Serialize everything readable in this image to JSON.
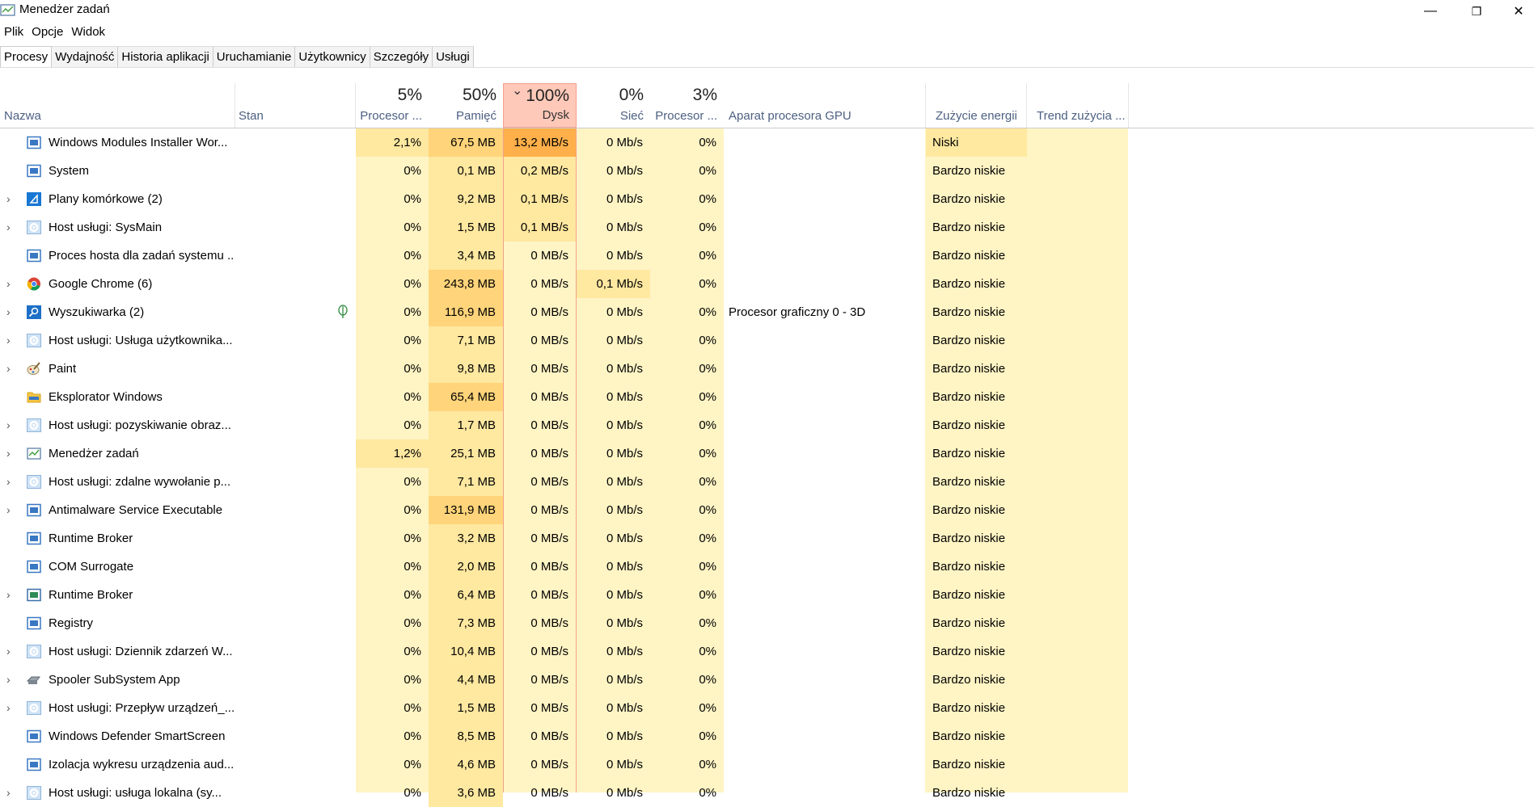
{
  "window": {
    "title": "Menedżer zadań",
    "minimize_glyph": "—",
    "restore_glyph": "❐",
    "close_glyph": "✕"
  },
  "menu": [
    "Plik",
    "Opcje",
    "Widok"
  ],
  "tabs": [
    "Procesy",
    "Wydajność",
    "Historia aplikacji",
    "Uruchamianie",
    "Użytkownicy",
    "Szczegóły",
    "Usługi"
  ],
  "active_tab": "Procesy",
  "columns": {
    "name": "Nazwa",
    "status": "Stan",
    "cpu": {
      "pct": "5%",
      "label": "Procesor ..."
    },
    "memory": {
      "pct": "50%",
      "label": "Pamięć"
    },
    "disk": {
      "pct": "100%",
      "label": "Dysk",
      "sort_arrow": "⌄"
    },
    "network": {
      "pct": "0%",
      "label": "Sieć"
    },
    "gpu": {
      "pct": "3%",
      "label": "Procesor ..."
    },
    "gpu_engine": "Aparat procesora GPU",
    "power": "Zużycie energii",
    "power_trend": "Trend zużycia ..."
  },
  "colors": {
    "heat_light": "#fff4c4",
    "heat_medium": "#ffe8a0",
    "heat_strong": "#ffd47a",
    "heat_hot": "#ffb04a",
    "disk_header_bg": "#ffc9b9",
    "disk_border": "#f4a08c",
    "header_label": "#4d6082"
  },
  "processes": [
    {
      "name": "Windows Modules Installer Wor...",
      "expand": "",
      "icon": "window-icon",
      "cpu": "2,1%",
      "mem": "67,5 MB",
      "disk": "13,2 MB/s",
      "net": "0 Mb/s",
      "gpu": "0%",
      "gpu_engine": "",
      "power": "Niski",
      "eco": false,
      "heat": {
        "cpu": "m",
        "mem": "s",
        "disk": "h",
        "net": "l",
        "power": "m"
      }
    },
    {
      "name": "System",
      "expand": "",
      "icon": "window-icon",
      "cpu": "0%",
      "mem": "0,1 MB",
      "disk": "0,2 MB/s",
      "net": "0 Mb/s",
      "gpu": "0%",
      "gpu_engine": "",
      "power": "Bardzo niskie",
      "eco": false,
      "heat": {
        "cpu": "l",
        "mem": "m",
        "disk": "m",
        "net": "l",
        "power": "l"
      }
    },
    {
      "name": "Plany komórkowe (2)",
      "expand": "›",
      "icon": "cellular-plans-icon",
      "cpu": "0%",
      "mem": "9,2 MB",
      "disk": "0,1 MB/s",
      "net": "0 Mb/s",
      "gpu": "0%",
      "gpu_engine": "",
      "power": "Bardzo niskie",
      "eco": false,
      "heat": {
        "cpu": "l",
        "mem": "m",
        "disk": "m",
        "net": "l",
        "power": "l"
      }
    },
    {
      "name": "Host usługi: SysMain",
      "expand": "›",
      "icon": "gear-icon",
      "cpu": "0%",
      "mem": "1,5 MB",
      "disk": "0,1 MB/s",
      "net": "0 Mb/s",
      "gpu": "0%",
      "gpu_engine": "",
      "power": "Bardzo niskie",
      "eco": false,
      "heat": {
        "cpu": "l",
        "mem": "m",
        "disk": "m",
        "net": "l",
        "power": "l"
      }
    },
    {
      "name": "Proces hosta dla zadań systemu ...",
      "expand": "",
      "icon": "window-icon",
      "cpu": "0%",
      "mem": "3,4 MB",
      "disk": "0 MB/s",
      "net": "0 Mb/s",
      "gpu": "0%",
      "gpu_engine": "",
      "power": "Bardzo niskie",
      "eco": false,
      "heat": {
        "cpu": "l",
        "mem": "m",
        "disk": "l",
        "net": "l",
        "power": "l"
      }
    },
    {
      "name": "Google Chrome (6)",
      "expand": "›",
      "icon": "chrome-icon",
      "cpu": "0%",
      "mem": "243,8 MB",
      "disk": "0 MB/s",
      "net": "0,1 Mb/s",
      "gpu": "0%",
      "gpu_engine": "",
      "power": "Bardzo niskie",
      "eco": false,
      "heat": {
        "cpu": "l",
        "mem": "s",
        "disk": "l",
        "net": "m",
        "power": "l"
      }
    },
    {
      "name": "Wyszukiwarka (2)",
      "expand": "›",
      "icon": "search-app-icon",
      "cpu": "0%",
      "mem": "116,9 MB",
      "disk": "0 MB/s",
      "net": "0 Mb/s",
      "gpu": "0%",
      "gpu_engine": "Procesor graficzny 0 - 3D",
      "power": "Bardzo niskie",
      "eco": true,
      "heat": {
        "cpu": "l",
        "mem": "s",
        "disk": "l",
        "net": "l",
        "power": "l"
      }
    },
    {
      "name": "Host usługi: Usługa użytkownika...",
      "expand": "›",
      "icon": "gear-icon",
      "cpu": "0%",
      "mem": "7,1 MB",
      "disk": "0 MB/s",
      "net": "0 Mb/s",
      "gpu": "0%",
      "gpu_engine": "",
      "power": "Bardzo niskie",
      "eco": false,
      "heat": {
        "cpu": "l",
        "mem": "m",
        "disk": "l",
        "net": "l",
        "power": "l"
      }
    },
    {
      "name": "Paint",
      "expand": "›",
      "icon": "paint-icon",
      "cpu": "0%",
      "mem": "9,8 MB",
      "disk": "0 MB/s",
      "net": "0 Mb/s",
      "gpu": "0%",
      "gpu_engine": "",
      "power": "Bardzo niskie",
      "eco": false,
      "heat": {
        "cpu": "l",
        "mem": "m",
        "disk": "l",
        "net": "l",
        "power": "l"
      }
    },
    {
      "name": "Eksplorator Windows",
      "expand": "",
      "icon": "folder-icon",
      "cpu": "0%",
      "mem": "65,4 MB",
      "disk": "0 MB/s",
      "net": "0 Mb/s",
      "gpu": "0%",
      "gpu_engine": "",
      "power": "Bardzo niskie",
      "eco": false,
      "heat": {
        "cpu": "l",
        "mem": "s",
        "disk": "l",
        "net": "l",
        "power": "l"
      }
    },
    {
      "name": "Host usługi: pozyskiwanie obraz...",
      "expand": "›",
      "icon": "gear-icon",
      "cpu": "0%",
      "mem": "1,7 MB",
      "disk": "0 MB/s",
      "net": "0 Mb/s",
      "gpu": "0%",
      "gpu_engine": "",
      "power": "Bardzo niskie",
      "eco": false,
      "heat": {
        "cpu": "l",
        "mem": "m",
        "disk": "l",
        "net": "l",
        "power": "l"
      }
    },
    {
      "name": "Menedżer zadań",
      "expand": "›",
      "icon": "task-manager-icon",
      "cpu": "1,2%",
      "mem": "25,1 MB",
      "disk": "0 MB/s",
      "net": "0 Mb/s",
      "gpu": "0%",
      "gpu_engine": "",
      "power": "Bardzo niskie",
      "eco": false,
      "heat": {
        "cpu": "m",
        "mem": "m",
        "disk": "l",
        "net": "l",
        "power": "l"
      }
    },
    {
      "name": "Host usługi: zdalne wywołanie p...",
      "expand": "›",
      "icon": "gear-icon",
      "cpu": "0%",
      "mem": "7,1 MB",
      "disk": "0 MB/s",
      "net": "0 Mb/s",
      "gpu": "0%",
      "gpu_engine": "",
      "power": "Bardzo niskie",
      "eco": false,
      "heat": {
        "cpu": "l",
        "mem": "m",
        "disk": "l",
        "net": "l",
        "power": "l"
      }
    },
    {
      "name": "Antimalware Service Executable",
      "expand": "›",
      "icon": "window-icon",
      "cpu": "0%",
      "mem": "131,9 MB",
      "disk": "0 MB/s",
      "net": "0 Mb/s",
      "gpu": "0%",
      "gpu_engine": "",
      "power": "Bardzo niskie",
      "eco": false,
      "heat": {
        "cpu": "l",
        "mem": "s",
        "disk": "l",
        "net": "l",
        "power": "l"
      }
    },
    {
      "name": "Runtime Broker",
      "expand": "",
      "icon": "window-icon",
      "cpu": "0%",
      "mem": "3,2 MB",
      "disk": "0 MB/s",
      "net": "0 Mb/s",
      "gpu": "0%",
      "gpu_engine": "",
      "power": "Bardzo niskie",
      "eco": false,
      "heat": {
        "cpu": "l",
        "mem": "m",
        "disk": "l",
        "net": "l",
        "power": "l"
      }
    },
    {
      "name": "COM Surrogate",
      "expand": "",
      "icon": "window-icon",
      "cpu": "0%",
      "mem": "2,0 MB",
      "disk": "0 MB/s",
      "net": "0 Mb/s",
      "gpu": "0%",
      "gpu_engine": "",
      "power": "Bardzo niskie",
      "eco": false,
      "heat": {
        "cpu": "l",
        "mem": "m",
        "disk": "l",
        "net": "l",
        "power": "l"
      }
    },
    {
      "name": "Runtime Broker",
      "expand": "›",
      "icon": "window-green-icon",
      "cpu": "0%",
      "mem": "6,4 MB",
      "disk": "0 MB/s",
      "net": "0 Mb/s",
      "gpu": "0%",
      "gpu_engine": "",
      "power": "Bardzo niskie",
      "eco": false,
      "heat": {
        "cpu": "l",
        "mem": "m",
        "disk": "l",
        "net": "l",
        "power": "l"
      }
    },
    {
      "name": "Registry",
      "expand": "",
      "icon": "window-icon",
      "cpu": "0%",
      "mem": "7,3 MB",
      "disk": "0 MB/s",
      "net": "0 Mb/s",
      "gpu": "0%",
      "gpu_engine": "",
      "power": "Bardzo niskie",
      "eco": false,
      "heat": {
        "cpu": "l",
        "mem": "m",
        "disk": "l",
        "net": "l",
        "power": "l"
      }
    },
    {
      "name": "Host usługi: Dziennik zdarzeń W...",
      "expand": "›",
      "icon": "gear-icon",
      "cpu": "0%",
      "mem": "10,4 MB",
      "disk": "0 MB/s",
      "net": "0 Mb/s",
      "gpu": "0%",
      "gpu_engine": "",
      "power": "Bardzo niskie",
      "eco": false,
      "heat": {
        "cpu": "l",
        "mem": "m",
        "disk": "l",
        "net": "l",
        "power": "l"
      }
    },
    {
      "name": "Spooler SubSystem App",
      "expand": "›",
      "icon": "printer-icon",
      "cpu": "0%",
      "mem": "4,4 MB",
      "disk": "0 MB/s",
      "net": "0 Mb/s",
      "gpu": "0%",
      "gpu_engine": "",
      "power": "Bardzo niskie",
      "eco": false,
      "heat": {
        "cpu": "l",
        "mem": "m",
        "disk": "l",
        "net": "l",
        "power": "l"
      }
    },
    {
      "name": "Host usługi: Przepływ urządzeń_...",
      "expand": "›",
      "icon": "gear-icon",
      "cpu": "0%",
      "mem": "1,5 MB",
      "disk": "0 MB/s",
      "net": "0 Mb/s",
      "gpu": "0%",
      "gpu_engine": "",
      "power": "Bardzo niskie",
      "eco": false,
      "heat": {
        "cpu": "l",
        "mem": "m",
        "disk": "l",
        "net": "l",
        "power": "l"
      }
    },
    {
      "name": "Windows Defender SmartScreen",
      "expand": "",
      "icon": "window-icon",
      "cpu": "0%",
      "mem": "8,5 MB",
      "disk": "0 MB/s",
      "net": "0 Mb/s",
      "gpu": "0%",
      "gpu_engine": "",
      "power": "Bardzo niskie",
      "eco": false,
      "heat": {
        "cpu": "l",
        "mem": "m",
        "disk": "l",
        "net": "l",
        "power": "l"
      }
    },
    {
      "name": "Izolacja wykresu urządzenia aud...",
      "expand": "",
      "icon": "window-icon",
      "cpu": "0%",
      "mem": "4,6 MB",
      "disk": "0 MB/s",
      "net": "0 Mb/s",
      "gpu": "0%",
      "gpu_engine": "",
      "power": "Bardzo niskie",
      "eco": false,
      "heat": {
        "cpu": "l",
        "mem": "m",
        "disk": "l",
        "net": "l",
        "power": "l"
      }
    },
    {
      "name": "Host usługi: usługa lokalna (sy...",
      "expand": "›",
      "icon": "gear-icon",
      "cpu": "0%",
      "mem": "3,6 MB",
      "disk": "0 MB/s",
      "net": "0 Mb/s",
      "gpu": "0%",
      "gpu_engine": "",
      "power": "Bardzo niskie",
      "eco": false,
      "heat": {
        "cpu": "l",
        "mem": "m",
        "disk": "l",
        "net": "l",
        "power": "l"
      }
    }
  ]
}
